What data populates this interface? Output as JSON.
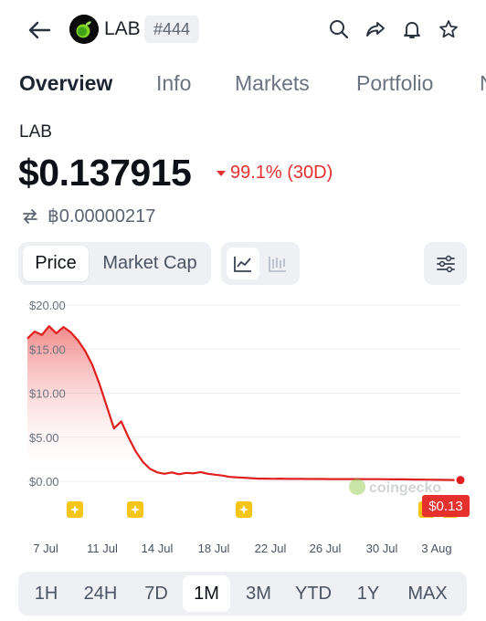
{
  "header": {
    "symbol": "LAB",
    "rank": "#444",
    "icons": [
      "back-arrow-icon",
      "search-icon",
      "share-icon",
      "bell-icon",
      "star-icon"
    ]
  },
  "tabs": [
    {
      "label": "Overview",
      "active": true
    },
    {
      "label": "Info",
      "active": false
    },
    {
      "label": "Markets",
      "active": false
    },
    {
      "label": "Portfolio",
      "active": false
    },
    {
      "label": "N",
      "active": false
    }
  ],
  "coin": {
    "name": "LAB",
    "price": "$0.137915",
    "change": "99.1% (30D)",
    "btc_price": "฿0.00000217"
  },
  "controls": {
    "price_label": "Price",
    "market_cap_label": "Market Cap"
  },
  "colors": {
    "down": "#e5302e",
    "line": "#e01e1e",
    "marker": "#f5c518"
  },
  "chart_data": {
    "type": "area",
    "y_ticks": [
      "$20.00",
      "$15.00",
      "$10.00",
      "$5.00",
      "$0.00"
    ],
    "ylim": [
      0,
      20
    ],
    "x_ticks": [
      "7 Jul",
      "11 Jul",
      "14 Jul",
      "18 Jul",
      "22 Jul",
      "26 Jul",
      "30 Jul",
      "3 Aug"
    ],
    "series": [
      {
        "values": [
          16.2,
          17.0,
          16.6,
          17.6,
          16.8,
          17.5,
          16.9,
          16.0,
          14.8,
          13.2,
          11.0,
          8.5,
          6.0,
          6.8,
          5.0,
          3.4,
          2.2,
          1.4,
          1.0,
          0.85,
          1.0,
          0.8,
          0.95,
          0.9,
          1.05,
          0.85,
          0.75,
          0.65,
          0.5,
          0.45,
          0.4,
          0.35,
          0.3,
          0.3,
          0.28,
          0.3,
          0.27,
          0.27,
          0.27,
          0.26,
          0.26,
          0.26,
          0.25,
          0.25,
          0.25,
          0.25,
          0.25,
          0.24,
          0.24,
          0.24,
          0.23,
          0.22,
          0.22,
          0.21,
          0.2,
          0.19,
          0.18,
          0.17,
          0.16,
          0.15,
          0.14
        ]
      }
    ],
    "last_price_label": "$0.13",
    "watermark": "coingecko",
    "event_markers": 5
  },
  "range_tabs": [
    {
      "label": "1H",
      "active": false
    },
    {
      "label": "24H",
      "active": false
    },
    {
      "label": "7D",
      "active": false
    },
    {
      "label": "1M",
      "active": true
    },
    {
      "label": "3M",
      "active": false
    },
    {
      "label": "YTD",
      "active": false
    },
    {
      "label": "1Y",
      "active": false
    },
    {
      "label": "MAX",
      "active": false
    }
  ]
}
